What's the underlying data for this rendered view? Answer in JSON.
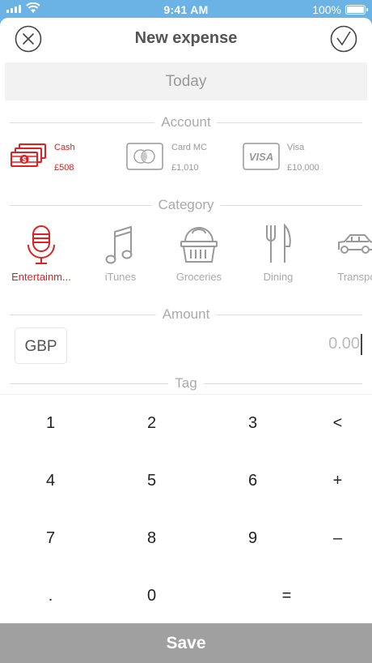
{
  "status_bar": {
    "time": "9:41 AM",
    "battery": "100%"
  },
  "header": {
    "title": "New expense",
    "close_icon": "close-circle-icon",
    "confirm_icon": "checkmark-circle-icon"
  },
  "date": {
    "value": "Today"
  },
  "account_section": {
    "label": "Account"
  },
  "accounts": [
    {
      "name": "Cash",
      "balance": "£508",
      "icon": "cash-icon",
      "color": "#e02020"
    },
    {
      "name": "Card MC",
      "balance": "£1,010",
      "icon": "mastercard-icon",
      "color": "#999999"
    },
    {
      "name": "Visa",
      "balance": "£10,000",
      "icon": "visa-icon",
      "color": "#999999"
    }
  ],
  "category_section": {
    "label": "Category"
  },
  "categories": [
    {
      "label": "Entertainm...",
      "icon": "microphone-icon",
      "selected": true
    },
    {
      "label": "iTunes",
      "icon": "music-note-icon",
      "selected": false
    },
    {
      "label": "Groceries",
      "icon": "basket-icon",
      "selected": false
    },
    {
      "label": "Dining",
      "icon": "fork-knife-icon",
      "selected": false
    },
    {
      "label": "Transpo",
      "icon": "car-icon",
      "selected": false
    }
  ],
  "amount_section": {
    "label": "Amount"
  },
  "amount": {
    "currency": "GBP",
    "value": "0.00"
  },
  "tag_section": {
    "label": "Tag"
  },
  "keypad": {
    "keys": [
      "1",
      "2",
      "3",
      "<",
      "4",
      "5",
      "6",
      "+",
      "7",
      "8",
      "9",
      "–",
      ".",
      "0",
      "="
    ]
  },
  "save": {
    "label": "Save"
  },
  "colors": {
    "accent": "#e02020",
    "status_bar": "#6ab3e4",
    "save_button": "#a0a0a0",
    "muted": "#aaaaaa"
  }
}
